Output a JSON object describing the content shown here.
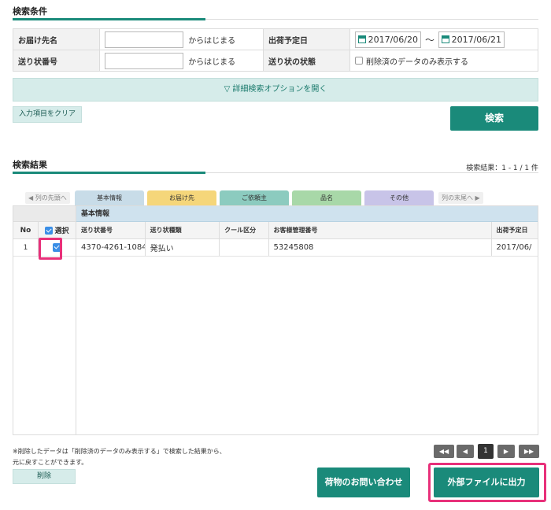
{
  "search": {
    "title": "検索条件",
    "delivery_name_label": "お届け先名",
    "delivery_name_suffix": "からはじまる",
    "tracking_no_label": "送り状番号",
    "tracking_no_suffix": "からはじまる",
    "ship_date_label": "出荷予定日",
    "date_from": "2017/06/20",
    "date_tilde": "〜",
    "date_to": "2017/06/21",
    "status_label": "送り状の状態",
    "deleted_only_label": "削除済のデータのみ表示する",
    "detail_options_label": "▽ 詳細検索オプションを開く",
    "clear_button": "入力項目をクリア",
    "search_button": "検索"
  },
  "results": {
    "title": "検索結果",
    "count_text": "検索結果：1 - 1 / 1 件",
    "nav_first": "◀ 列の先頭へ",
    "nav_last": "列の末尾へ ▶",
    "tabs": [
      {
        "label": "基本情報",
        "color": "#c8dce8"
      },
      {
        "label": "お届け先",
        "color": "#f5d67a"
      },
      {
        "label": "ご依頼主",
        "color": "#8ccbbf"
      },
      {
        "label": "品名",
        "color": "#a8d8a8"
      },
      {
        "label": "その他",
        "color": "#c8c4e8"
      }
    ],
    "group_label": "基本情報",
    "col_no": "No",
    "col_select": "選択",
    "columns": [
      "送り状番号",
      "送り状種類",
      "クール区分",
      "お客様管理番号",
      "出荷予定日"
    ],
    "rows": [
      {
        "no": "1",
        "selected": true,
        "cells": [
          "4370-4261-1084",
          "発払い",
          "",
          "53245808",
          "2017/06/"
        ]
      }
    ],
    "note_line1": "※削除したデータは「削除済のデータのみ表示する」で検索した結果から、",
    "note_line2": "元に戻すことができます。",
    "delete_button": "削除",
    "pager": {
      "first": "◀◀",
      "prev": "◀",
      "page": "1",
      "next": "▶",
      "last": "▶▶"
    },
    "inquiry_button": "荷物のお問い合わせ",
    "export_button": "外部ファイルに出力"
  },
  "colors": {
    "accent": "#1a8a7a",
    "highlight": "#e8307a",
    "checkbox": "#3a8ee6"
  }
}
